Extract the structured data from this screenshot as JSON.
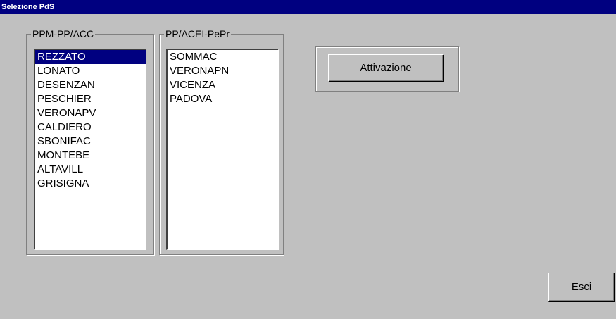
{
  "window": {
    "title": "Selezione PdS"
  },
  "group_left": {
    "label": "PPM-PP/ACC",
    "items": [
      "REZZATO",
      "LONATO",
      "DESENZAN",
      "PESCHIER",
      "VERONAPV",
      "CALDIERO",
      "SBONIFAC",
      "MONTEBE",
      "ALTAVILL",
      "GRISIGNA"
    ],
    "selected_index": 0
  },
  "group_right": {
    "label": "PP/ACEI-PePr",
    "items": [
      "SOMMAC",
      "VERONAPN",
      "VICENZA",
      "PADOVA"
    ]
  },
  "buttons": {
    "activate": "Attivazione",
    "exit": "Esci"
  },
  "colors": {
    "selection": "#000080",
    "titlebar": "#000080",
    "face": "#c0c0c0"
  }
}
